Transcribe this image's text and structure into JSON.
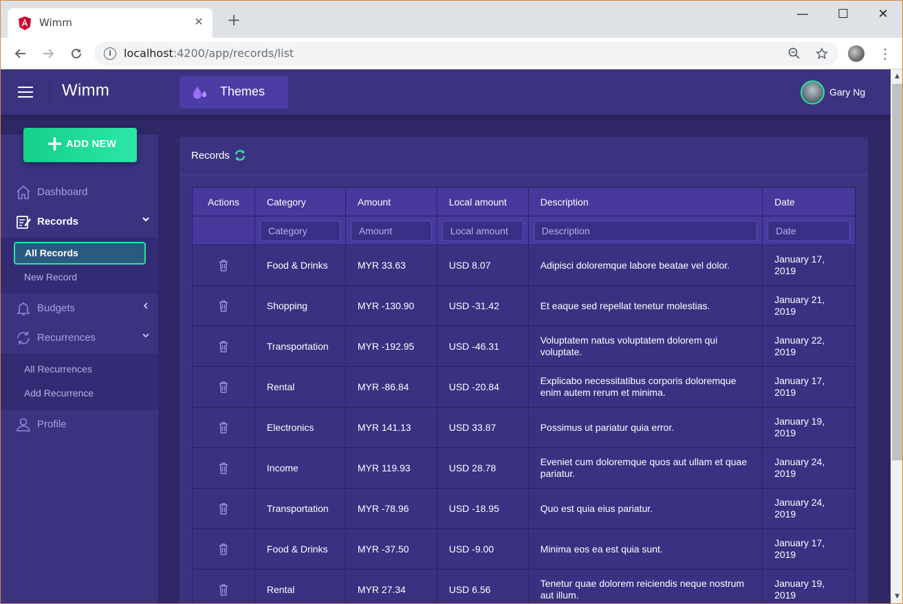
{
  "browser": {
    "tab_title": "Wimm",
    "tab_close": "✕",
    "new_tab": "+",
    "url_host": "localhost",
    "url_rest": ":4200/app/records/list",
    "minimize": "—",
    "maximize": "☐",
    "close": "✕"
  },
  "header": {
    "brand": "Wimm",
    "themes_label": "Themes",
    "user_name": "Gary Ng"
  },
  "sidebar": {
    "add_new": "ADD NEW",
    "items": {
      "dashboard": "Dashboard",
      "records": "Records",
      "budgets": "Budgets",
      "recurrences": "Recurrences",
      "profile": "Profile"
    },
    "records_sub": [
      "All Records",
      "New Record"
    ],
    "recurrences_sub": [
      "All Recurrences",
      "Add Recurrence"
    ]
  },
  "card": {
    "title": "Records"
  },
  "table": {
    "columns": [
      "Actions",
      "Category",
      "Amount",
      "Local amount",
      "Description",
      "Date"
    ],
    "filters": [
      "Category",
      "Amount",
      "Local amount",
      "Description",
      "Date"
    ],
    "rows": [
      {
        "category": "Food & Drinks",
        "amount": "MYR 33.63",
        "local": "USD 8.07",
        "description": "Adipisci doloremque labore beatae vel dolor.",
        "date": "January 17, 2019"
      },
      {
        "category": "Shopping",
        "amount": "MYR -130.90",
        "local": "USD -31.42",
        "description": "Et eaque sed repellat tenetur molestias.",
        "date": "January 21, 2019"
      },
      {
        "category": "Transportation",
        "amount": "MYR -192.95",
        "local": "USD -46.31",
        "description": "Voluptatem natus voluptatem dolorem qui voluptate.",
        "date": "January 22, 2019"
      },
      {
        "category": "Rental",
        "amount": "MYR -86.84",
        "local": "USD -20.84",
        "description": "Explicabo necessitatibus corporis doloremque enim autem rerum et minima.",
        "date": "January 17, 2019"
      },
      {
        "category": "Electronics",
        "amount": "MYR 141.13",
        "local": "USD 33.87",
        "description": "Possimus ut pariatur quia error.",
        "date": "January 19, 2019"
      },
      {
        "category": "Income",
        "amount": "MYR 119.93",
        "local": "USD 28.78",
        "description": "Eveniet cum doloremque quos aut ullam et quae pariatur.",
        "date": "January 24, 2019"
      },
      {
        "category": "Transportation",
        "amount": "MYR -78.96",
        "local": "USD -18.95",
        "description": "Quo est quia eius pariatur.",
        "date": "January 24, 2019"
      },
      {
        "category": "Food & Drinks",
        "amount": "MYR -37.50",
        "local": "USD -9.00",
        "description": "Minima eos ea est quia sunt.",
        "date": "January 17, 2019"
      },
      {
        "category": "Rental",
        "amount": "MYR 27.34",
        "local": "USD 6.56",
        "description": "Tenetur quae dolorem reiciendis neque nostrum aut illum.",
        "date": "January 19, 2019"
      }
    ]
  },
  "colors": {
    "accent": "#29e5a0",
    "header_bg": "#3c3380",
    "page_bg": "#2f2766",
    "table_head": "#47399c"
  }
}
